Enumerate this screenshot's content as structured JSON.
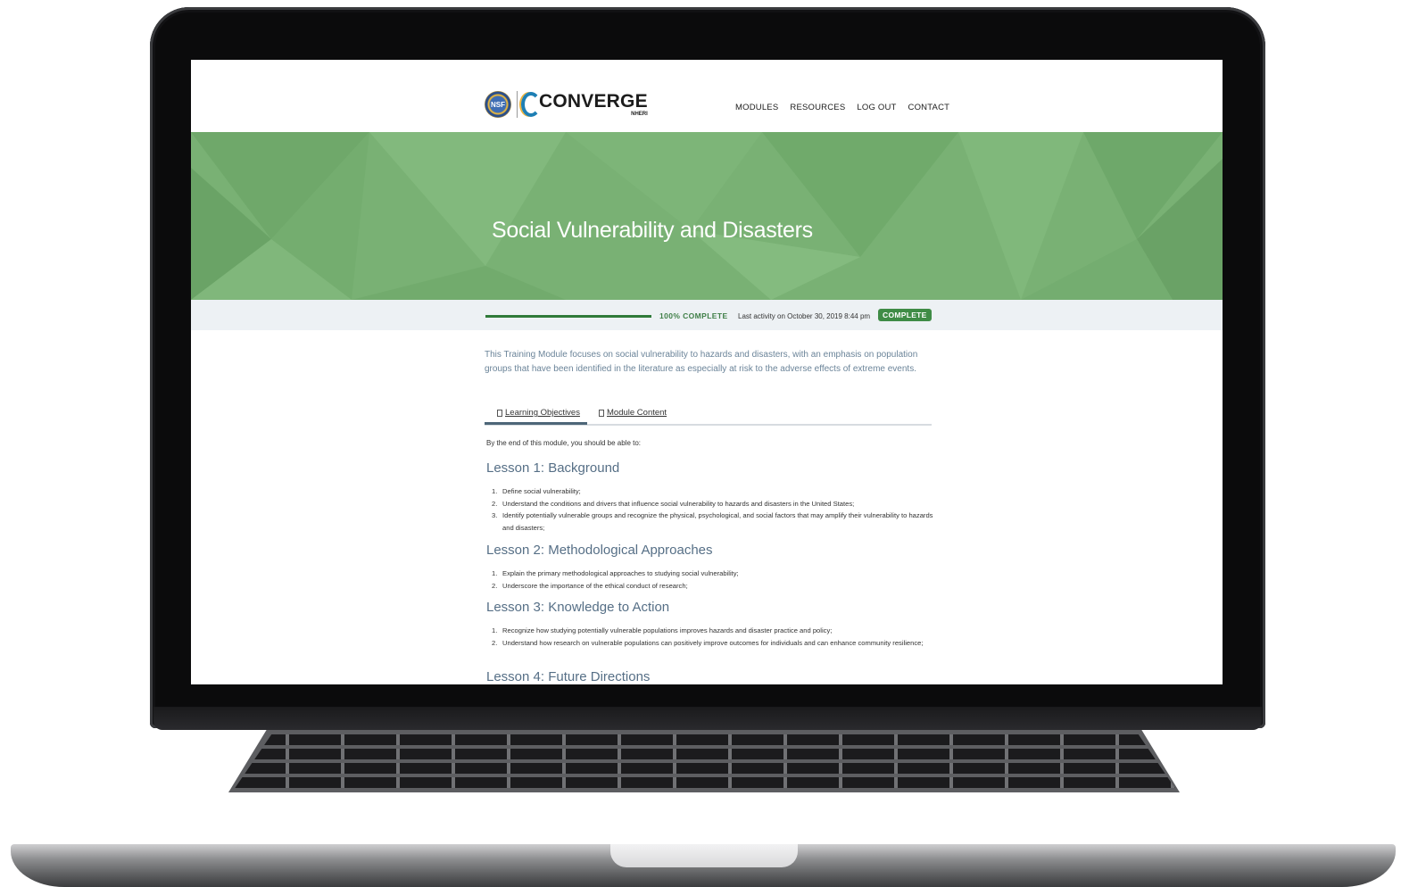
{
  "header": {
    "logo_seal_text": "NSF",
    "logo_name": "CONVERGE",
    "logo_sub": "NHERI",
    "nav": [
      "MODULES",
      "RESOURCES",
      "LOG OUT",
      "CONTACT"
    ]
  },
  "hero": {
    "title": "Social Vulnerability and Disasters"
  },
  "progress": {
    "percent": 100,
    "label": "100% COMPLETE",
    "last_activity": "Last activity on October 30, 2019 8:44 pm",
    "badge": "COMPLETE"
  },
  "intro": "This Training Module focuses on social vulnerability to hazards and disasters, with an emphasis on population groups that have been identified in the literature as especially at risk to the adverse effects of extreme events.",
  "tabs": [
    {
      "label": "Learning Objectives",
      "active": true
    },
    {
      "label": "Module Content",
      "active": false
    }
  ],
  "objectives_intro": "By the end of this module, you should be able to:",
  "lessons": [
    {
      "title": "Lesson 1: Background",
      "items": [
        "Define social vulnerability;",
        "Understand the conditions and drivers that influence social vulnerability to hazards and disasters in the United States;",
        "Identify potentially vulnerable groups and recognize the physical, psychological, and social factors that may amplify their vulnerability to hazards and disasters;"
      ]
    },
    {
      "title": "Lesson 2: Methodological Approaches",
      "items": [
        "Explain the primary methodological approaches to studying social vulnerability;",
        "Underscore the importance of the ethical conduct of research;"
      ]
    },
    {
      "title": "Lesson 3: Knowledge to Action",
      "items": [
        "Recognize how studying potentially vulnerable populations improves hazards and disaster practice and policy;",
        "Understand how research on vulnerable populations can positively improve outcomes for individuals and can enhance community resilience;"
      ]
    },
    {
      "title": "Lesson 4: Future Directions",
      "items": []
    }
  ],
  "colors": {
    "hero_green": "#79b174",
    "progress_green": "#2f7a39",
    "badge_green": "#3f8c46",
    "heading_blue": "#566f86"
  }
}
